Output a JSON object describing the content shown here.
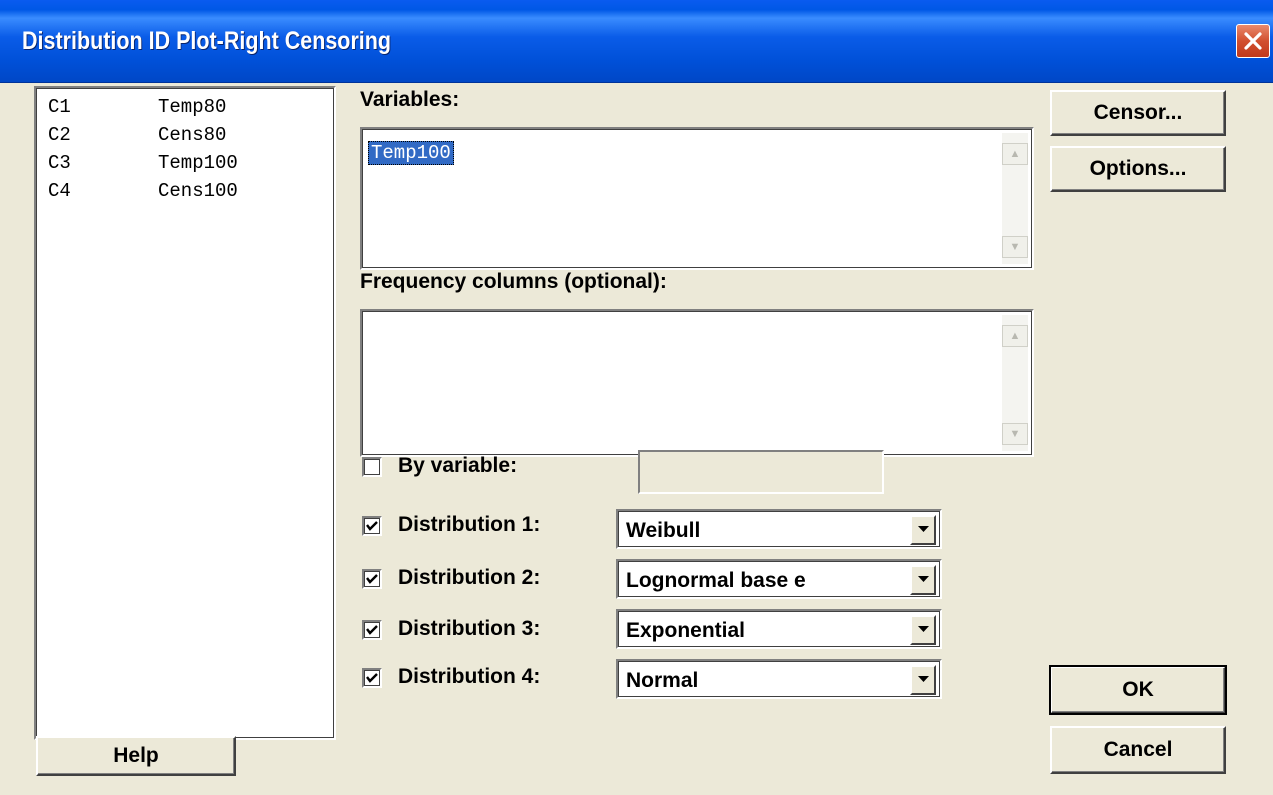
{
  "window": {
    "title": "Distribution ID Plot-Right Censoring"
  },
  "variables_list": [
    {
      "id": "C1",
      "name": "Temp80"
    },
    {
      "id": "C2",
      "name": "Cens80"
    },
    {
      "id": "C3",
      "name": "Temp100"
    },
    {
      "id": "C4",
      "name": "Cens100"
    }
  ],
  "variables": {
    "label": "Variables:",
    "value": "Temp100"
  },
  "frequency": {
    "label": "Frequency columns (optional):",
    "value": ""
  },
  "by_variable": {
    "label": "By variable:",
    "checked": false,
    "value": ""
  },
  "distributions": [
    {
      "label": "Distribution 1:",
      "checked": true,
      "value": "Weibull"
    },
    {
      "label": "Distribution 2:",
      "checked": true,
      "value": "Lognormal base e"
    },
    {
      "label": "Distribution 3:",
      "checked": true,
      "value": "Exponential"
    },
    {
      "label": "Distribution 4:",
      "checked": true,
      "value": "Normal"
    }
  ],
  "buttons": {
    "censor": "Censor...",
    "options": "Options...",
    "help": "Help",
    "ok": "OK",
    "cancel": "Cancel"
  },
  "icons": {
    "close": "close-icon",
    "checkmark": "checkmark-icon",
    "dropdown": "chevron-down-icon"
  },
  "colors": {
    "titlebar": "#0058e6",
    "close_button": "#d2502f",
    "dialog_background": "#ece9d8",
    "selection": "#316ac5"
  }
}
